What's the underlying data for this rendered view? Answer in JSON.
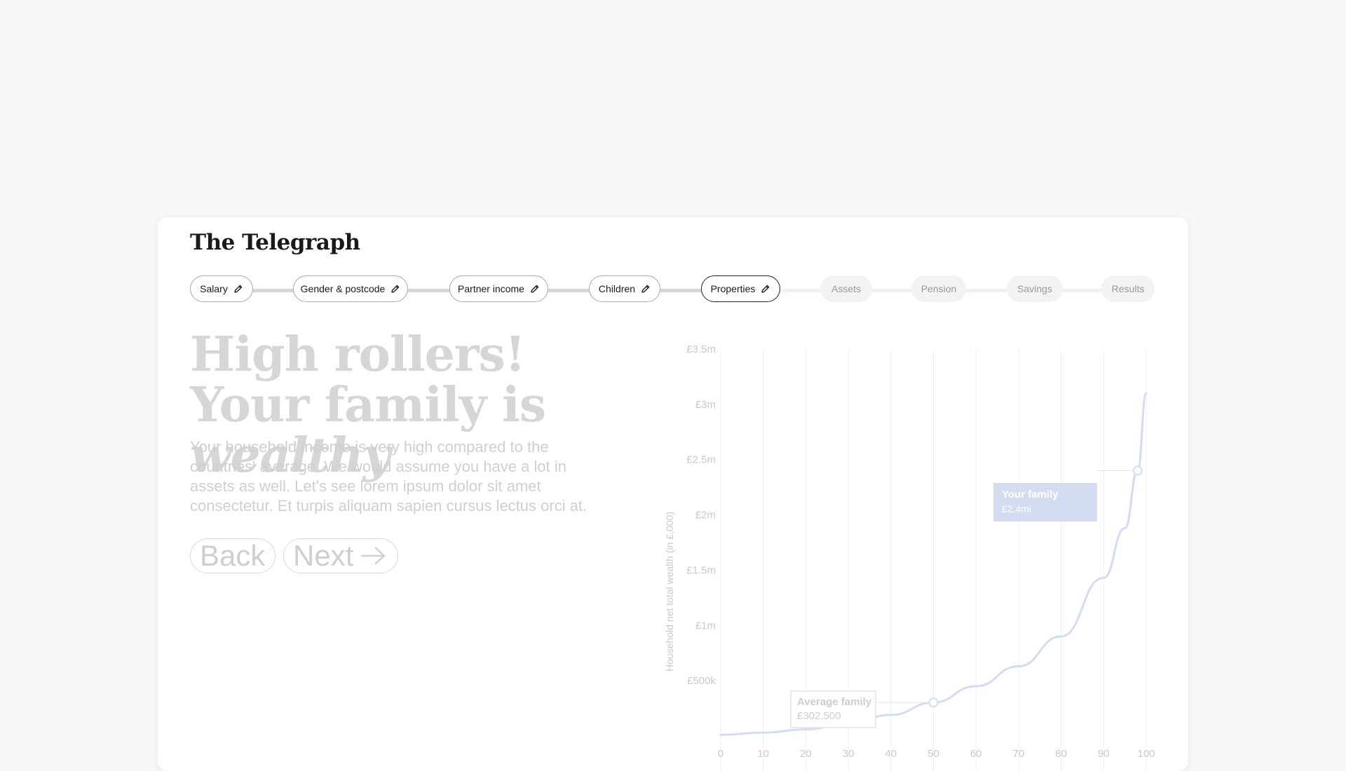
{
  "brand": {
    "logo_text": "The Telegraph"
  },
  "stepper": {
    "steps": [
      {
        "label": "Salary",
        "state": "done",
        "icon": "pencil-icon"
      },
      {
        "label": "Gender & postcode",
        "state": "done",
        "icon": "pencil-icon"
      },
      {
        "label": "Partner income",
        "state": "done",
        "icon": "pencil-icon"
      },
      {
        "label": "Children",
        "state": "done",
        "icon": "pencil-icon"
      },
      {
        "label": "Properties",
        "state": "current",
        "icon": "pencil-icon"
      },
      {
        "label": "Assets",
        "state": "todo"
      },
      {
        "label": "Pension",
        "state": "todo"
      },
      {
        "label": "Savings",
        "state": "todo"
      },
      {
        "label": "Results",
        "state": "todo"
      }
    ]
  },
  "main": {
    "headline_part1": "High rollers! Your family is",
    "headline_emph": "wealthy",
    "description": "Your household income is very high compared to the countries' average. We would assume you have a lot in assets as well. Let's see lorem ipsum dolor sit amet consectetur. Et turpis aliquam sapien cursus lectus orci at.",
    "back_label": "Back",
    "next_label": "Next",
    "next_icon": "arrow-right-icon"
  },
  "colors": {
    "accent": "#d4dcf2",
    "line": "#d4dcf2",
    "muted_text": "#cfcfcf",
    "axis_text": "#c9c9c9"
  },
  "chart_data": {
    "type": "line",
    "ylabel": "Household net total wealth (in £,000)",
    "xlabel": "",
    "ylim": [
      0,
      3500000
    ],
    "xlim": [
      0,
      100
    ],
    "y_ticks": [
      {
        "value": 500000,
        "label": "£500k"
      },
      {
        "value": 1000000,
        "label": "£1m"
      },
      {
        "value": 1500000,
        "label": "£1.5m"
      },
      {
        "value": 2000000,
        "label": "£2m"
      },
      {
        "value": 2500000,
        "label": "£2.5m"
      },
      {
        "value": 3000000,
        "label": "£3m"
      },
      {
        "value": 3500000,
        "label": "£3.5m"
      }
    ],
    "x_ticks": [
      0,
      10,
      20,
      30,
      40,
      50,
      60,
      70,
      80,
      90,
      100
    ],
    "grid": true,
    "series": [
      {
        "x": [
          0,
          10,
          20,
          30,
          40,
          50,
          60,
          70,
          80,
          90,
          95,
          98,
          100
        ],
        "y": [
          10000,
          30000,
          60000,
          110000,
          190000,
          302500,
          450000,
          630000,
          900000,
          1430000,
          1880000,
          2400000,
          3100000
        ]
      }
    ],
    "annotations": [
      {
        "title": "Your family",
        "value_label": "£2,4mi",
        "x": 98,
        "y": 2400000,
        "style": "filled"
      },
      {
        "title": "Average family",
        "value_label": "£302,500",
        "x": 50,
        "y": 302500,
        "style": "outline"
      }
    ]
  }
}
